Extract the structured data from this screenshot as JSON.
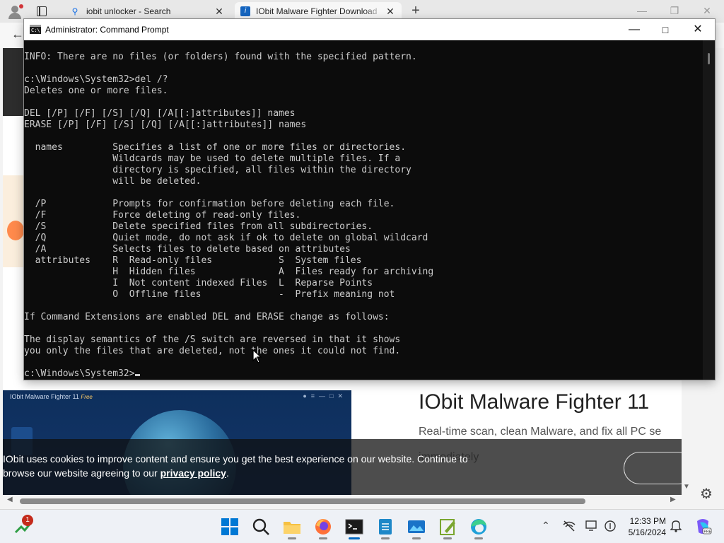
{
  "browser": {
    "tabs": [
      {
        "title": "iobit unlocker - Search",
        "icon": "search-icon"
      },
      {
        "title": "IObit Malware Fighter Download",
        "icon": "iobit-icon"
      }
    ],
    "new_tab_label": "+"
  },
  "page": {
    "promo_bar_title": "IObit Malware Fighter 11",
    "promo_bar_tag": "Free",
    "product_title": "IObit Malware Fighter 11",
    "product_subtitle": "Real-time scan, clean Malware, and fix all PC se",
    "product_subtitle2": "immediately",
    "cookie_text": "IObit uses cookies to improve content and ensure you get the best experience on our website. Continue to browse our website agreeing to our ",
    "cookie_link": "privacy policy",
    "cookie_end": "."
  },
  "cmd": {
    "title": "Administrator: Command Prompt",
    "lines": [
      "INFO: There are no files (or folders) found with the specified pattern.",
      "",
      "c:\\Windows\\System32>del /?",
      "Deletes one or more files.",
      "",
      "DEL [/P] [/F] [/S] [/Q] [/A[[:]attributes]] names",
      "ERASE [/P] [/F] [/S] [/Q] [/A[[:]attributes]] names",
      "",
      "  names         Specifies a list of one or more files or directories.",
      "                Wildcards may be used to delete multiple files. If a",
      "                directory is specified, all files within the directory",
      "                will be deleted.",
      "",
      "  /P            Prompts for confirmation before deleting each file.",
      "  /F            Force deleting of read-only files.",
      "  /S            Delete specified files from all subdirectories.",
      "  /Q            Quiet mode, do not ask if ok to delete on global wildcard",
      "  /A            Selects files to delete based on attributes",
      "  attributes    R  Read-only files            S  System files",
      "                H  Hidden files               A  Files ready for archiving",
      "                I  Not content indexed Files  L  Reparse Points",
      "                O  Offline files              -  Prefix meaning not",
      "",
      "If Command Extensions are enabled DEL and ERASE change as follows:",
      "",
      "The display semantics of the /S switch are reversed in that it shows",
      "you only the files that are deleted, not the ones it could not find.",
      ""
    ],
    "prompt": "c:\\Windows\\System32>"
  },
  "taskbar": {
    "notification_count": "1",
    "time": "12:33 PM",
    "date": "5/16/2024",
    "apps": [
      "start-icon",
      "search-icon",
      "file-explorer-icon",
      "firefox-icon",
      "terminal-icon",
      "notepad-icon",
      "photos-icon",
      "notepad-plus-icon",
      "edge-icon"
    ]
  },
  "colors": {
    "console_bg": "#0c0c0c",
    "console_fg": "#cccccc",
    "accent": "#0067c0"
  }
}
